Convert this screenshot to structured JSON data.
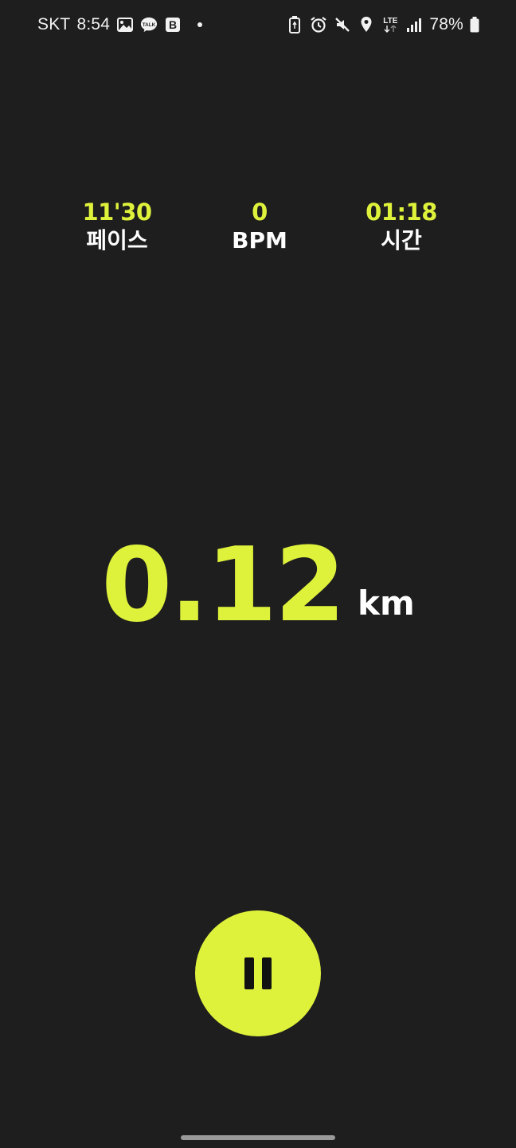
{
  "status_bar": {
    "carrier": "SKT",
    "time": "8:54",
    "battery_percent": "78%",
    "network_type": "LTE",
    "left_icons": [
      "image-icon",
      "kakaotalk-icon",
      "b-app-icon",
      "notification-dot-icon"
    ],
    "right_icons": [
      "battery-saver-icon",
      "alarm-icon",
      "mute-icon",
      "location-icon",
      "lte-icon",
      "signal-icon",
      "battery-icon"
    ]
  },
  "stats": {
    "pace": {
      "value": "11'30",
      "label": "페이스"
    },
    "bpm": {
      "value": "0",
      "label": "BPM"
    },
    "time": {
      "value": "01:18",
      "label": "시간"
    }
  },
  "distance": {
    "value": "0.12",
    "unit": "km"
  },
  "controls": {
    "pause_icon": "pause-icon"
  },
  "colors": {
    "background": "#1e1e1e",
    "accent": "#dff23b",
    "text": "#ffffff"
  }
}
